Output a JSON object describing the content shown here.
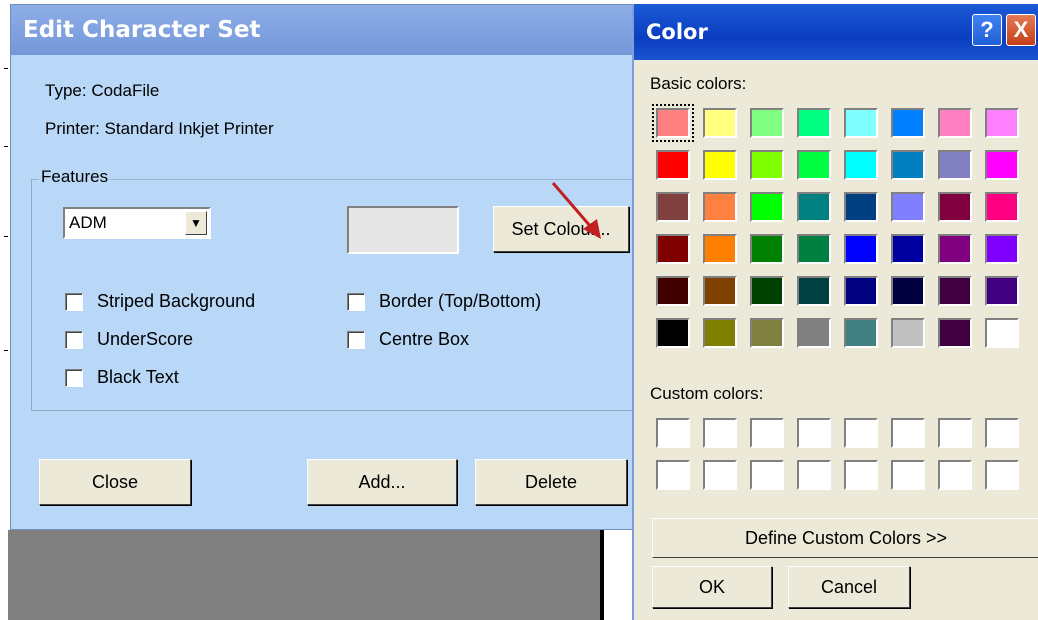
{
  "edit_window": {
    "title": "Edit Character Set",
    "type_label": "Type:",
    "type_value": "CodaFile",
    "printer_label": "Printer:",
    "printer_value": "Standard Inkjet Printer",
    "features_legend": "Features",
    "dropdown_value": "ADM",
    "set_colour_label": "Set Colour...",
    "checkboxes": [
      {
        "label": "Striped Background",
        "checked": false
      },
      {
        "label": "UnderScore",
        "checked": false
      },
      {
        "label": "Black Text",
        "checked": false
      },
      {
        "label": "Border (Top/Bottom)",
        "checked": false
      },
      {
        "label": "Centre Box",
        "checked": false
      }
    ],
    "close_label": "Close",
    "add_label": "Add...",
    "delete_label": "Delete",
    "swatch_color": "#e6e6e6"
  },
  "color_dialog": {
    "title": "Color",
    "help_icon": "help-icon",
    "close_icon": "close-icon",
    "help_glyph": "?",
    "close_glyph": "X",
    "basic_label": "Basic colors:",
    "custom_label": "Custom colors:",
    "define_label": "Define Custom Colors >>",
    "ok_label": "OK",
    "cancel_label": "Cancel",
    "selected_index": 0,
    "basic_colors": [
      "#ff8080",
      "#ffff80",
      "#80ff80",
      "#00ff80",
      "#80ffff",
      "#0080ff",
      "#ff80c0",
      "#ff80ff",
      "#ff0000",
      "#ffff00",
      "#80ff00",
      "#00ff40",
      "#00ffff",
      "#0080c0",
      "#8080c0",
      "#ff00ff",
      "#804040",
      "#ff8040",
      "#00ff00",
      "#008080",
      "#004080",
      "#8080ff",
      "#800040",
      "#ff0080",
      "#800000",
      "#ff8000",
      "#008000",
      "#008040",
      "#0000ff",
      "#0000a0",
      "#800080",
      "#8000ff",
      "#400000",
      "#804000",
      "#004000",
      "#004040",
      "#000080",
      "#000040",
      "#400040",
      "#400080",
      "#000000",
      "#808000",
      "#808040",
      "#808080",
      "#408080",
      "#c0c0c0",
      "#400040",
      "#ffffff"
    ],
    "custom_colors": [
      "#ffffff",
      "#ffffff",
      "#ffffff",
      "#ffffff",
      "#ffffff",
      "#ffffff",
      "#ffffff",
      "#ffffff",
      "#ffffff",
      "#ffffff",
      "#ffffff",
      "#ffffff",
      "#ffffff",
      "#ffffff",
      "#ffffff",
      "#ffffff"
    ]
  }
}
